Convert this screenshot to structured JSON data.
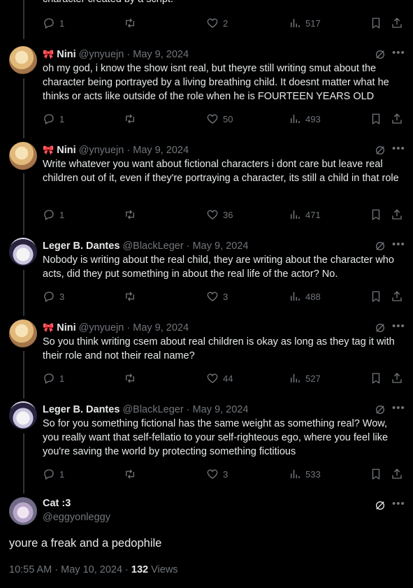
{
  "top_cut_text": "character created by a script.",
  "tweets": [
    {
      "name": "Nini",
      "handle": "@ynyuejn",
      "date": "May 9, 2024",
      "deco": "🎀",
      "text": "oh my god, i know the show isnt real, but theyre still writing smut about the character being portrayed by a living breathing child. It doesnt matter what he thinks or acts like outside of the role when he is FOURTEEN YEARS OLD",
      "replies": "1",
      "retweets": "",
      "likes": "50",
      "views": "493"
    },
    {
      "name": "Nini",
      "handle": "@ynyuejn",
      "date": "May 9, 2024",
      "deco": "🎀",
      "text": "Write whatever you want about fictional characters i dont care but leave real children out of it, even if they're portraying a character, its still a child in that role",
      "replies": "1",
      "retweets": "",
      "likes": "36",
      "views": "471"
    },
    {
      "name": "Leger B. Dantes",
      "handle": "@BlackLeger",
      "date": "May 9, 2024",
      "text": "Nobody is writing about the real child, they are writing about the character who acts, did they put something in about the real life of the actor? No.",
      "replies": "3",
      "retweets": "",
      "likes": "3",
      "views": "488"
    },
    {
      "name": "Nini",
      "handle": "@ynyuejn",
      "date": "May 9, 2024",
      "deco": "🎀",
      "text": "So you think writing csem about real children is okay as long as they tag it with their role and not their real name?",
      "replies": "1",
      "retweets": "",
      "likes": "44",
      "views": "527"
    },
    {
      "name": "Leger B. Dantes",
      "handle": "@BlackLeger",
      "date": "May 9, 2024",
      "text": "So for you something fictional has the same weight as something real? Wow, you really want that self-fellatio to your self-righteous ego, where you feel like you're saving the world by protecting something fictitious",
      "replies": "1",
      "retweets": "",
      "likes": "3",
      "views": "533"
    }
  ],
  "top_actions": {
    "replies": "1",
    "likes": "2",
    "views": "517"
  },
  "main": {
    "name": "Cat :3",
    "handle": "@eggyonleggy",
    "text": "youre a freak and a pedophile",
    "time": "10:55 AM · May 10, 2024 · ",
    "views_count": "132",
    "views_label": " Views"
  },
  "sep": " · ",
  "colors": {
    "background": "#000000",
    "text": "#e7e9ea",
    "muted": "#71767b",
    "line": "#333639"
  }
}
